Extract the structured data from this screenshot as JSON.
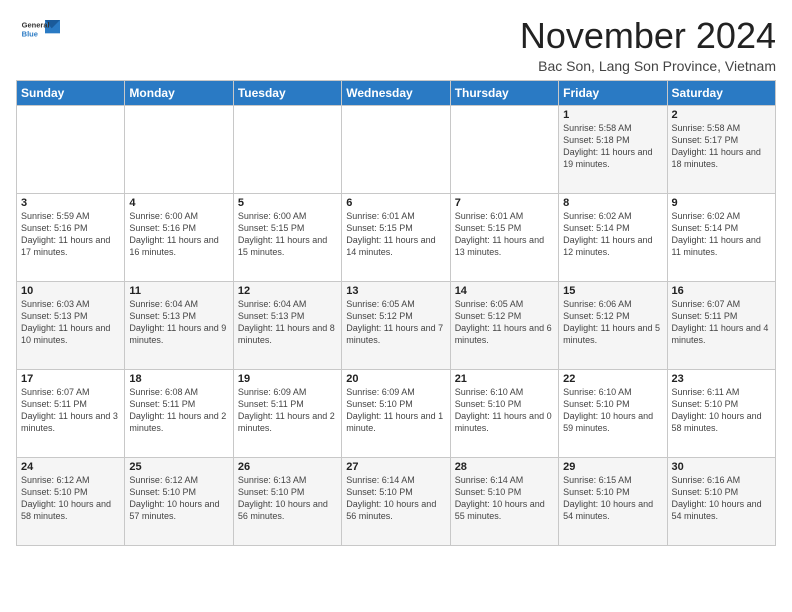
{
  "header": {
    "logo_general": "General",
    "logo_blue": "Blue",
    "month_title": "November 2024",
    "location": "Bac Son, Lang Son Province, Vietnam"
  },
  "weekdays": [
    "Sunday",
    "Monday",
    "Tuesday",
    "Wednesday",
    "Thursday",
    "Friday",
    "Saturday"
  ],
  "weeks": [
    [
      {
        "day": "",
        "info": ""
      },
      {
        "day": "",
        "info": ""
      },
      {
        "day": "",
        "info": ""
      },
      {
        "day": "",
        "info": ""
      },
      {
        "day": "",
        "info": ""
      },
      {
        "day": "1",
        "info": "Sunrise: 5:58 AM\nSunset: 5:18 PM\nDaylight: 11 hours and 19 minutes."
      },
      {
        "day": "2",
        "info": "Sunrise: 5:58 AM\nSunset: 5:17 PM\nDaylight: 11 hours and 18 minutes."
      }
    ],
    [
      {
        "day": "3",
        "info": "Sunrise: 5:59 AM\nSunset: 5:16 PM\nDaylight: 11 hours and 17 minutes."
      },
      {
        "day": "4",
        "info": "Sunrise: 6:00 AM\nSunset: 5:16 PM\nDaylight: 11 hours and 16 minutes."
      },
      {
        "day": "5",
        "info": "Sunrise: 6:00 AM\nSunset: 5:15 PM\nDaylight: 11 hours and 15 minutes."
      },
      {
        "day": "6",
        "info": "Sunrise: 6:01 AM\nSunset: 5:15 PM\nDaylight: 11 hours and 14 minutes."
      },
      {
        "day": "7",
        "info": "Sunrise: 6:01 AM\nSunset: 5:15 PM\nDaylight: 11 hours and 13 minutes."
      },
      {
        "day": "8",
        "info": "Sunrise: 6:02 AM\nSunset: 5:14 PM\nDaylight: 11 hours and 12 minutes."
      },
      {
        "day": "9",
        "info": "Sunrise: 6:02 AM\nSunset: 5:14 PM\nDaylight: 11 hours and 11 minutes."
      }
    ],
    [
      {
        "day": "10",
        "info": "Sunrise: 6:03 AM\nSunset: 5:13 PM\nDaylight: 11 hours and 10 minutes."
      },
      {
        "day": "11",
        "info": "Sunrise: 6:04 AM\nSunset: 5:13 PM\nDaylight: 11 hours and 9 minutes."
      },
      {
        "day": "12",
        "info": "Sunrise: 6:04 AM\nSunset: 5:13 PM\nDaylight: 11 hours and 8 minutes."
      },
      {
        "day": "13",
        "info": "Sunrise: 6:05 AM\nSunset: 5:12 PM\nDaylight: 11 hours and 7 minutes."
      },
      {
        "day": "14",
        "info": "Sunrise: 6:05 AM\nSunset: 5:12 PM\nDaylight: 11 hours and 6 minutes."
      },
      {
        "day": "15",
        "info": "Sunrise: 6:06 AM\nSunset: 5:12 PM\nDaylight: 11 hours and 5 minutes."
      },
      {
        "day": "16",
        "info": "Sunrise: 6:07 AM\nSunset: 5:11 PM\nDaylight: 11 hours and 4 minutes."
      }
    ],
    [
      {
        "day": "17",
        "info": "Sunrise: 6:07 AM\nSunset: 5:11 PM\nDaylight: 11 hours and 3 minutes."
      },
      {
        "day": "18",
        "info": "Sunrise: 6:08 AM\nSunset: 5:11 PM\nDaylight: 11 hours and 2 minutes."
      },
      {
        "day": "19",
        "info": "Sunrise: 6:09 AM\nSunset: 5:11 PM\nDaylight: 11 hours and 2 minutes."
      },
      {
        "day": "20",
        "info": "Sunrise: 6:09 AM\nSunset: 5:10 PM\nDaylight: 11 hours and 1 minute."
      },
      {
        "day": "21",
        "info": "Sunrise: 6:10 AM\nSunset: 5:10 PM\nDaylight: 11 hours and 0 minutes."
      },
      {
        "day": "22",
        "info": "Sunrise: 6:10 AM\nSunset: 5:10 PM\nDaylight: 10 hours and 59 minutes."
      },
      {
        "day": "23",
        "info": "Sunrise: 6:11 AM\nSunset: 5:10 PM\nDaylight: 10 hours and 58 minutes."
      }
    ],
    [
      {
        "day": "24",
        "info": "Sunrise: 6:12 AM\nSunset: 5:10 PM\nDaylight: 10 hours and 58 minutes."
      },
      {
        "day": "25",
        "info": "Sunrise: 6:12 AM\nSunset: 5:10 PM\nDaylight: 10 hours and 57 minutes."
      },
      {
        "day": "26",
        "info": "Sunrise: 6:13 AM\nSunset: 5:10 PM\nDaylight: 10 hours and 56 minutes."
      },
      {
        "day": "27",
        "info": "Sunrise: 6:14 AM\nSunset: 5:10 PM\nDaylight: 10 hours and 56 minutes."
      },
      {
        "day": "28",
        "info": "Sunrise: 6:14 AM\nSunset: 5:10 PM\nDaylight: 10 hours and 55 minutes."
      },
      {
        "day": "29",
        "info": "Sunrise: 6:15 AM\nSunset: 5:10 PM\nDaylight: 10 hours and 54 minutes."
      },
      {
        "day": "30",
        "info": "Sunrise: 6:16 AM\nSunset: 5:10 PM\nDaylight: 10 hours and 54 minutes."
      }
    ]
  ]
}
